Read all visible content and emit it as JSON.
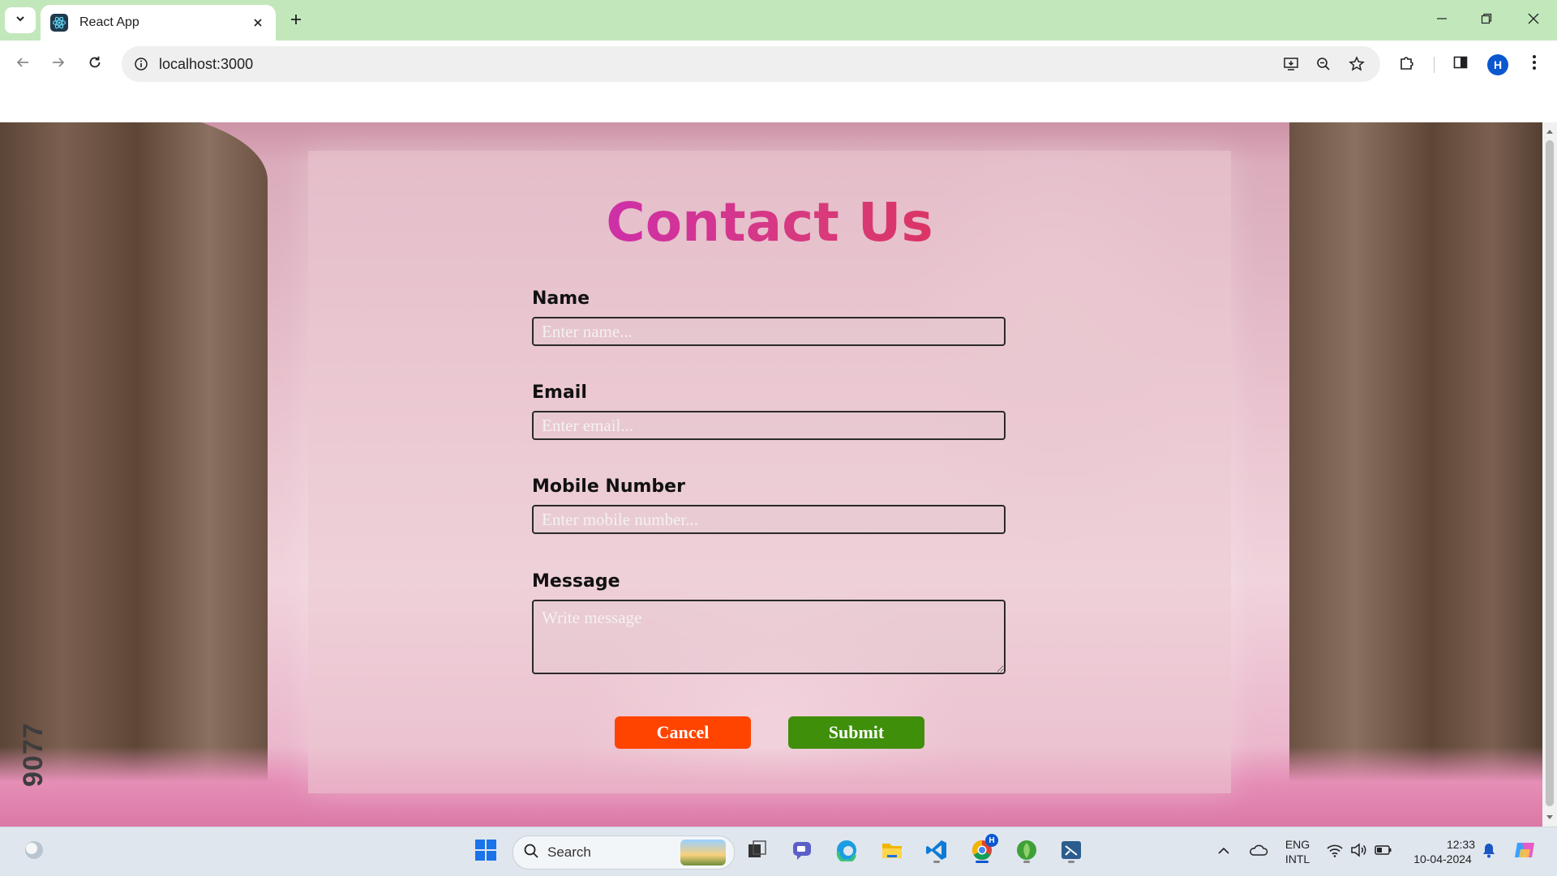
{
  "browser": {
    "tab_title": "React App",
    "url": "localhost:3000",
    "profile_initial": "H"
  },
  "form": {
    "title": "Contact Us",
    "fields": [
      {
        "label": "Name",
        "placeholder": "Enter name..."
      },
      {
        "label": "Email",
        "placeholder": "Enter email..."
      },
      {
        "label": "Mobile Number",
        "placeholder": "Enter mobile number..."
      },
      {
        "label": "Message",
        "placeholder": "Write message"
      }
    ],
    "cancel_label": "Cancel",
    "submit_label": "Submit"
  },
  "background": {
    "watermark_text": "9077"
  },
  "taskbar": {
    "search_label": "Search",
    "language_top": "ENG",
    "language_bottom": "INTL",
    "time": "12:33",
    "date": "10-04-2024",
    "chrome_badge": "H"
  },
  "colors": {
    "tabbar_bg": "#c2e7bb",
    "title_gradient_start": "#c021e6",
    "title_gradient_end": "#e3262e",
    "cancel_bg": "#ff4400",
    "submit_bg": "#3f8f0a"
  }
}
